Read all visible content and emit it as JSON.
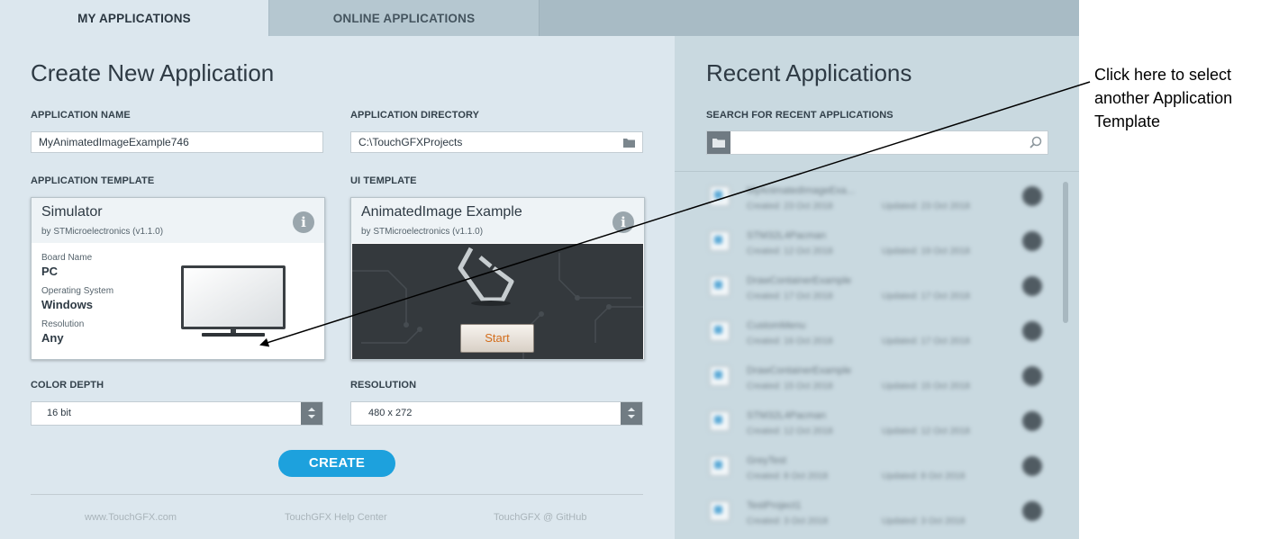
{
  "tabs": [
    {
      "label": "MY APPLICATIONS",
      "active": true
    },
    {
      "label": "ONLINE APPLICATIONS",
      "active": false
    }
  ],
  "create": {
    "title": "Create New Application",
    "app_name": {
      "label": "APPLICATION NAME",
      "value": "MyAnimatedImageExample746"
    },
    "app_dir": {
      "label": "APPLICATION DIRECTORY",
      "value": "C:\\TouchGFXProjects"
    },
    "app_template": {
      "label": "APPLICATION TEMPLATE",
      "name": "Simulator",
      "vendor": "by STMicroelectronics (v1.1.0)",
      "board_label": "Board Name",
      "board_value": "PC",
      "os_label": "Operating System",
      "os_value": "Windows",
      "res_label": "Resolution",
      "res_value": "Any"
    },
    "ui_template": {
      "label": "UI TEMPLATE",
      "name": "AnimatedImage Example",
      "vendor": "by STMicroelectronics (v1.1.0)",
      "preview_button": "Start"
    },
    "color_depth": {
      "label": "COLOR DEPTH",
      "value": "16 bit"
    },
    "resolution": {
      "label": "RESOLUTION",
      "value": "480 x 272"
    },
    "create_button": "CREATE",
    "footer_links": [
      "www.TouchGFX.com",
      "TouchGFX Help Center",
      "TouchGFX @ GitHub"
    ]
  },
  "recent": {
    "title": "Recent Applications",
    "search_label": "SEARCH FOR RECENT APPLICATIONS",
    "search_value": "",
    "items": [
      {
        "name": "MyAnimatedImageExa...",
        "created": "Created: 23 Oct 2018",
        "updated": "Updated: 23 Oct 2018"
      },
      {
        "name": "STM32L4Pacman",
        "created": "Created: 12 Oct 2018",
        "updated": "Updated: 19 Oct 2018"
      },
      {
        "name": "DrawContainerExample",
        "created": "Created: 17 Oct 2018",
        "updated": "Updated: 17 Oct 2018"
      },
      {
        "name": "CustomMenu",
        "created": "Created: 16 Oct 2018",
        "updated": "Updated: 17 Oct 2018"
      },
      {
        "name": "DrawContainerExample",
        "created": "Created: 15 Oct 2018",
        "updated": "Updated: 15 Oct 2018"
      },
      {
        "name": "STM32L4Pacman",
        "created": "Created: 12 Oct 2018",
        "updated": "Updated: 12 Oct 2018"
      },
      {
        "name": "GreyTest",
        "created": "Created: 8 Oct 2018",
        "updated": "Updated: 8 Oct 2018"
      },
      {
        "name": "TestProject1",
        "created": "Created: 3 Oct 2018",
        "updated": "Updated: 3 Oct 2018"
      }
    ]
  },
  "annotation": {
    "text": "Click here to select another Application Template"
  }
}
